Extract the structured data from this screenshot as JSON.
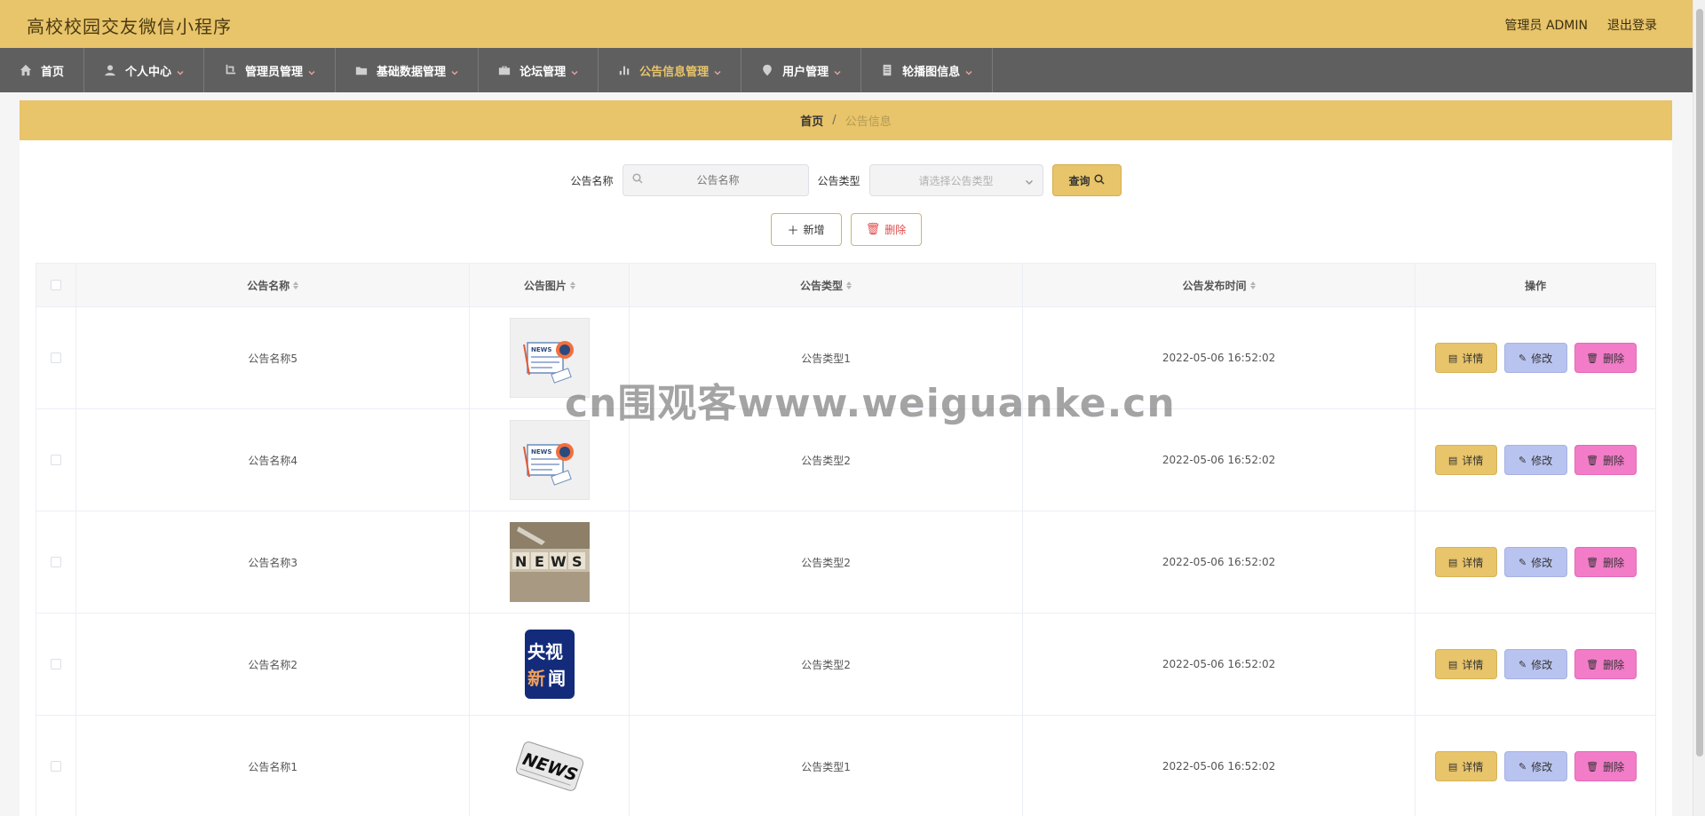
{
  "header": {
    "title": "高校校园交友微信小程序",
    "admin_label": "管理员 ADMIN",
    "logout_label": "退出登录"
  },
  "nav": [
    {
      "label": "首页",
      "icon": "home-icon",
      "caret": false,
      "active": false
    },
    {
      "label": "个人中心",
      "icon": "user-icon",
      "caret": true,
      "active": false
    },
    {
      "label": "管理员管理",
      "icon": "crop-icon",
      "caret": true,
      "active": false
    },
    {
      "label": "基础数据管理",
      "icon": "folder-icon",
      "caret": true,
      "active": false
    },
    {
      "label": "论坛管理",
      "icon": "briefcase-icon",
      "caret": true,
      "active": false
    },
    {
      "label": "公告信息管理",
      "icon": "bar-chart-icon",
      "caret": true,
      "active": true
    },
    {
      "label": "用户管理",
      "icon": "location-icon",
      "caret": true,
      "active": false
    },
    {
      "label": "轮播图信息",
      "icon": "document-icon",
      "caret": true,
      "active": false
    }
  ],
  "breadcrumb": {
    "home": "首页",
    "separator": "/",
    "current": "公告信息"
  },
  "search": {
    "name_label": "公告名称",
    "name_placeholder": "公告名称",
    "type_label": "公告类型",
    "type_placeholder": "请选择公告类型",
    "query_label": "查询"
  },
  "actions": {
    "add_label": "新增",
    "delete_label": "删除"
  },
  "table": {
    "headers": {
      "name": "公告名称",
      "image": "公告图片",
      "type": "公告类型",
      "time": "公告发布时间",
      "ops": "操作"
    },
    "op_labels": {
      "detail": "详情",
      "edit": "修改",
      "delete": "删除"
    },
    "rows": [
      {
        "name": "公告名称5",
        "type": "公告类型1",
        "time": "2022-05-06 16:52:02",
        "image": "news-paper-icon"
      },
      {
        "name": "公告名称4",
        "type": "公告类型2",
        "time": "2022-05-06 16:52:02",
        "image": "news-paper-icon"
      },
      {
        "name": "公告名称3",
        "type": "公告类型2",
        "time": "2022-05-06 16:52:02",
        "image": "news-blocks-icon"
      },
      {
        "name": "公告名称2",
        "type": "公告类型2",
        "time": "2022-05-06 16:52:02",
        "image": "cctv-news-icon"
      },
      {
        "name": "公告名称1",
        "type": "公告类型1",
        "time": "2022-05-06 16:52:02",
        "image": "newspaper-roll-icon"
      }
    ]
  },
  "watermark": "cn围观客www.weiguanke.cn",
  "colors": {
    "accent": "#e8c46a",
    "nav_bg": "#5f5f5f",
    "edit": "#b9c3ef",
    "delete": "#f27cc8"
  }
}
